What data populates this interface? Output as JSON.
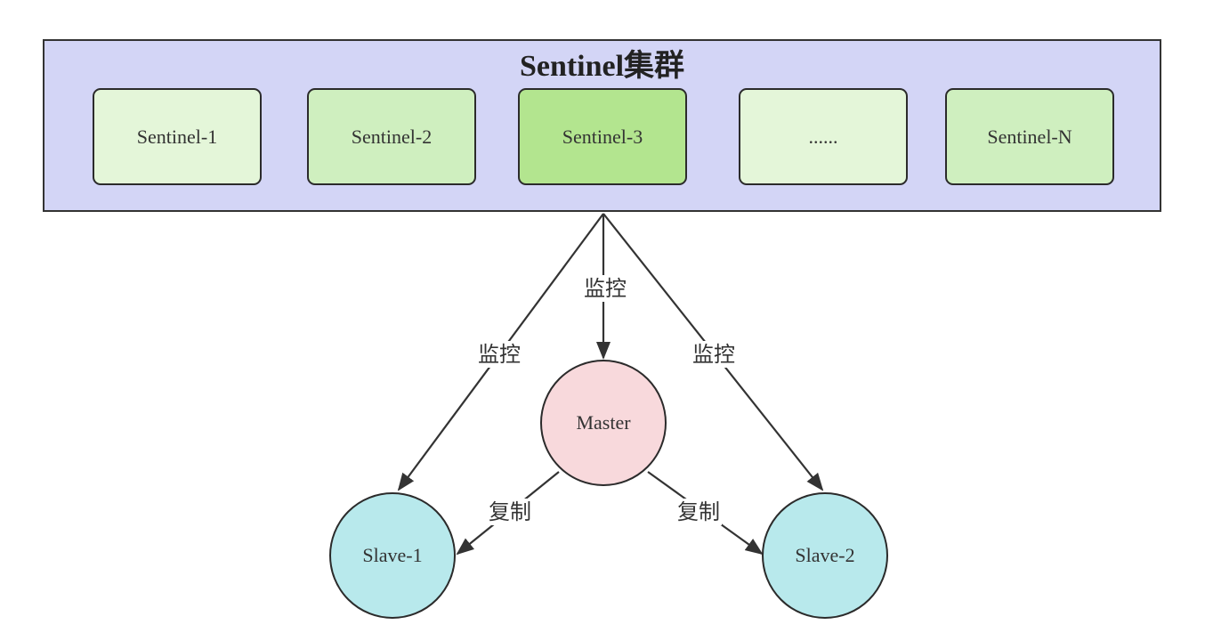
{
  "colors": {
    "cluster_fill": "#d3d5f6",
    "sentinel_fills": [
      "#e4f6d9",
      "#cfefbf",
      "#b3e58f",
      "#e4f6d9",
      "#cfefbf"
    ],
    "master_fill": "#f8d9dc",
    "slave_fill": "#b8e9ec",
    "stroke": "#333333"
  },
  "cluster": {
    "title": "Sentinel集群",
    "sentinels": [
      "Sentinel-1",
      "Sentinel-2",
      "Sentinel-3",
      "......",
      "Sentinel-N"
    ]
  },
  "nodes": {
    "master": "Master",
    "slave1": "Slave-1",
    "slave2": "Slave-2"
  },
  "edges": {
    "monitor_label": "监控",
    "replicate_label": "复制"
  }
}
